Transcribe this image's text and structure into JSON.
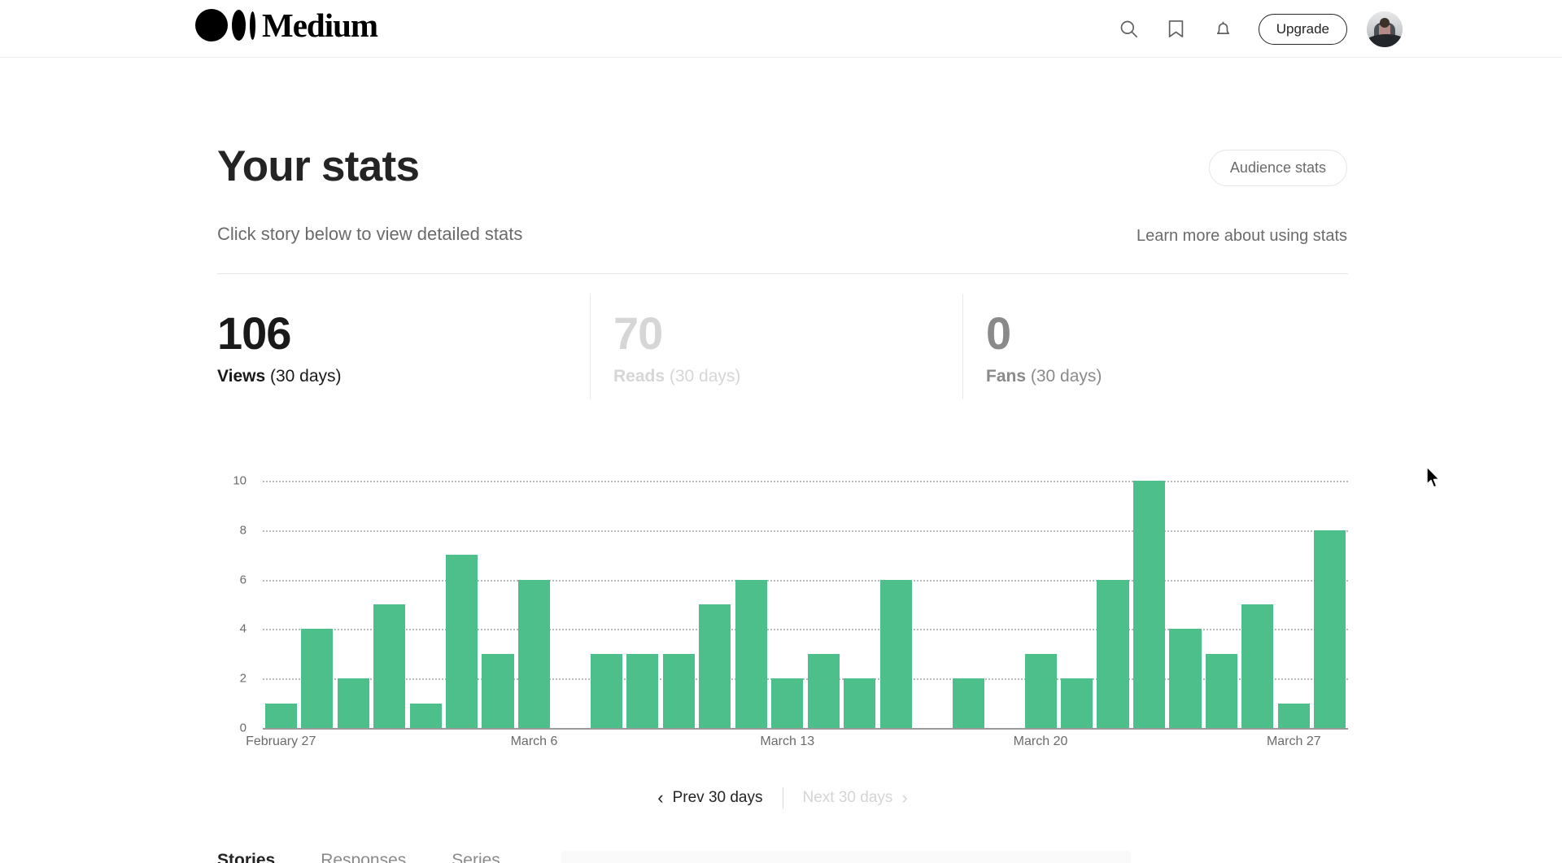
{
  "header": {
    "logo_text": "Medium",
    "icons": [
      {
        "name": "search-icon",
        "label": "Search"
      },
      {
        "name": "bookmark-icon",
        "label": "Bookmarks"
      },
      {
        "name": "bell-icon",
        "label": "Notifications"
      }
    ],
    "upgrade_label": "Upgrade",
    "avatar_label": "Profile"
  },
  "page": {
    "title": "Your stats",
    "audience_button": "Audience stats",
    "subtitle": "Click story below to view detailed stats",
    "learn_link": "Learn more about using stats"
  },
  "stats": [
    {
      "key": "views",
      "value": "106",
      "name": "Views",
      "period": " (30 days)",
      "state": "active"
    },
    {
      "key": "reads",
      "value": "70",
      "name": "Reads",
      "period": " (30 days)",
      "state": "muted"
    },
    {
      "key": "fans",
      "value": "0",
      "name": "Fans",
      "period": " (30 days)",
      "state": "inactive"
    }
  ],
  "pager": {
    "prev_label": "Prev 30 days",
    "next_label": "Next 30 days",
    "prev_chevron": "‹",
    "next_chevron": "›",
    "prev_enabled": true,
    "next_enabled": false
  },
  "bottom_tabs": [
    {
      "label": "Stories",
      "active": true
    },
    {
      "label": "Responses",
      "active": false
    },
    {
      "label": "Series",
      "active": false
    }
  ],
  "colors": {
    "bar_green": "#4CBF8B",
    "text_primary": "#242424",
    "text_muted": "#6b6b6b",
    "text_disabled": "#d6d6d6",
    "grid": "#b9b9b9"
  },
  "chart_data": {
    "type": "bar",
    "title": "Views (30 days)",
    "xlabel": "",
    "ylabel": "",
    "ylim": [
      0,
      10
    ],
    "yticks": [
      0,
      2,
      4,
      6,
      8,
      10
    ],
    "grid": true,
    "legend": false,
    "xtick_labels": [
      "February 27",
      "March 6",
      "March 13",
      "March 20",
      "March 27"
    ],
    "xtick_indices": [
      0,
      7,
      14,
      21,
      28
    ],
    "categories": [
      "February 27",
      "February 28",
      "March 1",
      "March 2",
      "March 3",
      "March 4",
      "March 5",
      "March 6",
      "March 7",
      "March 8",
      "March 9",
      "March 10",
      "March 11",
      "March 12",
      "March 13",
      "March 14",
      "March 15",
      "March 16",
      "March 17",
      "March 18",
      "March 19",
      "March 20",
      "March 21",
      "March 22",
      "March 23",
      "March 24",
      "March 25",
      "March 26",
      "March 27",
      "March 28"
    ],
    "values": [
      1,
      4,
      2,
      5,
      1,
      7,
      3,
      6,
      0,
      3,
      3,
      3,
      5,
      6,
      2,
      3,
      2,
      6,
      0,
      2,
      0,
      3,
      2,
      6,
      10,
      4,
      3,
      5,
      1,
      8
    ],
    "total": 106
  }
}
